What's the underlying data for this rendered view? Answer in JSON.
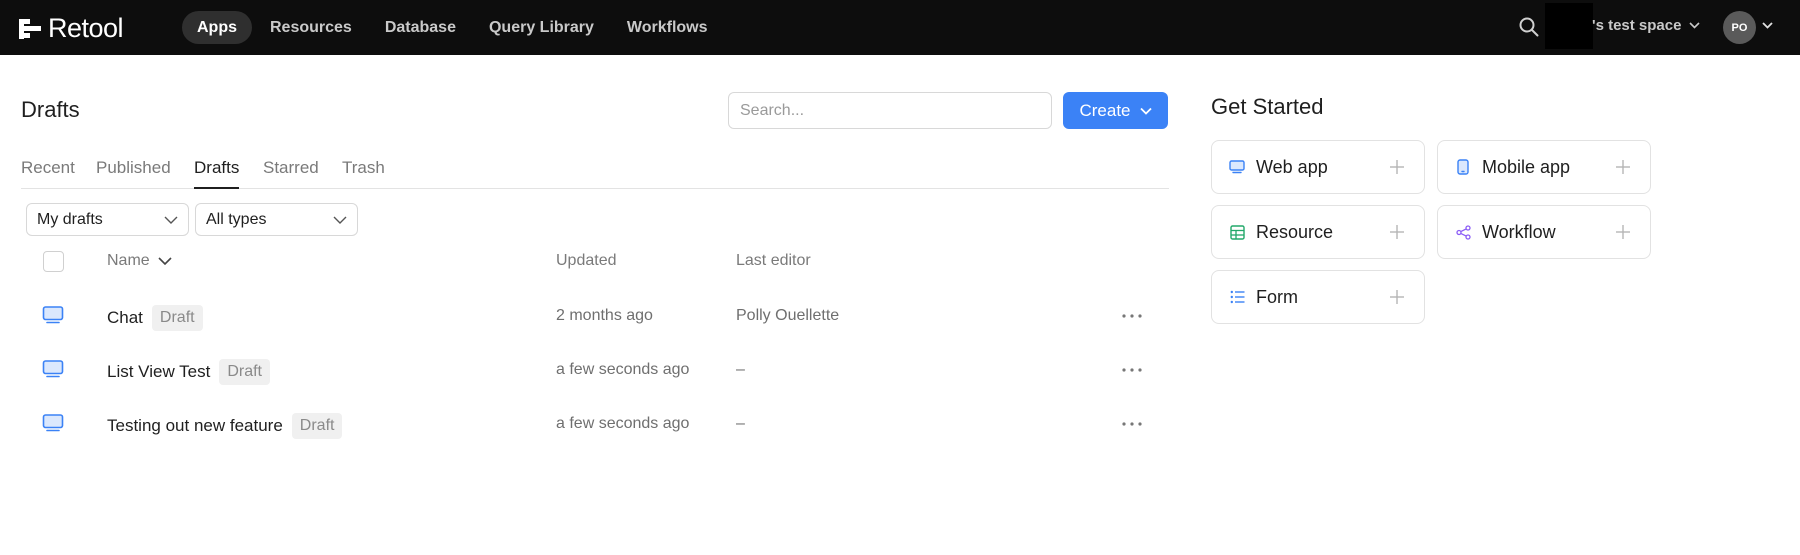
{
  "topbar": {
    "brand": "Retool",
    "nav": [
      {
        "label": "Apps",
        "active": true
      },
      {
        "label": "Resources",
        "active": false
      },
      {
        "label": "Database",
        "active": false
      },
      {
        "label": "Query Library",
        "active": false
      },
      {
        "label": "Workflows",
        "active": false
      }
    ],
    "space_label": "'s test space",
    "avatar_initials": "PO"
  },
  "main": {
    "title": "Drafts",
    "search_placeholder": "Search...",
    "create_label": "Create",
    "tabs": [
      {
        "label": "Recent",
        "active": false
      },
      {
        "label": "Published",
        "active": false
      },
      {
        "label": "Drafts",
        "active": true
      },
      {
        "label": "Starred",
        "active": false
      },
      {
        "label": "Trash",
        "active": false
      }
    ],
    "filters": {
      "owner": "My drafts",
      "type": "All types"
    },
    "columns": {
      "name": "Name",
      "updated": "Updated",
      "editor": "Last editor"
    },
    "rows": [
      {
        "name": "Chat",
        "badge": "Draft",
        "updated": "2 months ago",
        "editor": "Polly Ouellette"
      },
      {
        "name": "List View Test",
        "badge": "Draft",
        "updated": "a few seconds ago",
        "editor": "–"
      },
      {
        "name": "Testing out new feature",
        "badge": "Draft",
        "updated": "a few seconds ago",
        "editor": "–"
      }
    ]
  },
  "get_started": {
    "title": "Get Started",
    "cards": [
      {
        "label": "Web app",
        "icon": "monitor-icon"
      },
      {
        "label": "Mobile app",
        "icon": "phone-icon"
      },
      {
        "label": "Resource",
        "icon": "table-icon"
      },
      {
        "label": "Workflow",
        "icon": "share-nodes-icon"
      },
      {
        "label": "Form",
        "icon": "list-icon"
      }
    ]
  },
  "colors": {
    "accent": "#3b82f6",
    "topbar_bg": "#0d0d0d",
    "resource_icon": "#22a86a",
    "workflow_icon": "#8b5cf6"
  }
}
